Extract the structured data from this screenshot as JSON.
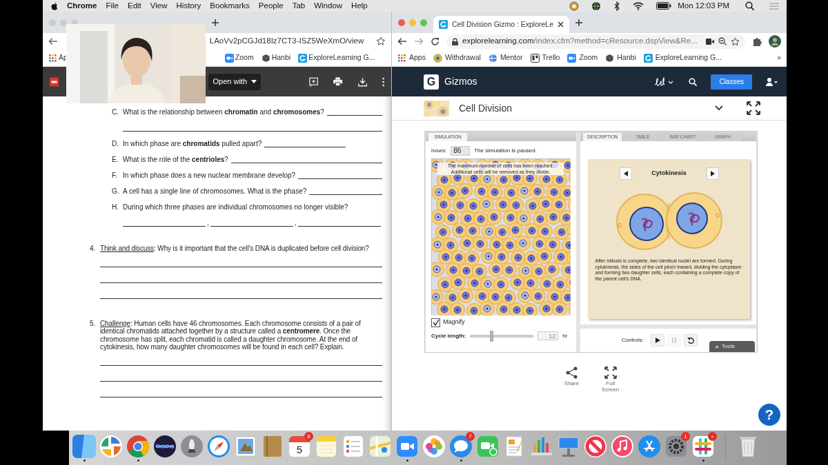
{
  "menu_bar": {
    "app": "Chrome",
    "menus": [
      "File",
      "Edit",
      "View",
      "History",
      "Bookmarks",
      "People",
      "Tab",
      "Window",
      "Help"
    ],
    "clock": "Mon 12:03 PM"
  },
  "left_window": {
    "address": "LAoVv2pCGJd18Iz7CT3-ISZ5WeXmO/view",
    "bookmarks_start": [
      {
        "kind": "grid",
        "label": "Ap"
      }
    ],
    "bookmarks": [
      {
        "kind": "camera",
        "label": "Zoom"
      },
      {
        "kind": "cube",
        "label": "Hanbi"
      },
      {
        "kind": "square-logo",
        "label": "ExploreLearning G..."
      }
    ],
    "open_with": "Open with"
  },
  "pdf": {
    "questions": [
      {
        "letter": "C.",
        "text": "What is the relationship between **chromatin** and **chromosomes**?",
        "kind": "inline-and-line"
      },
      {
        "letter": "D.",
        "text": "In which phase are **chromatids** pulled apart?",
        "kind": "short"
      },
      {
        "letter": "E.",
        "text": "What is the role of the **centrioles**?",
        "kind": "inline"
      },
      {
        "letter": "F.",
        "text": "In which phase does a new nuclear membrane develop?",
        "kind": "inline"
      },
      {
        "letter": "G.",
        "text": "A cell has a single line of chromosomes. What is the phase?",
        "kind": "inline"
      },
      {
        "letter": "H.",
        "text": "During which three phases are individual chromosomes no longer visible?",
        "kind": "three-blanks",
        "separators": [
          ",",
          ","
        ]
      }
    ],
    "numbered": [
      {
        "number": "4.",
        "label": "Think and discuss",
        "text": ": Why is it important that the cell's DNA is duplicated before cell division?",
        "kind": "three-lines"
      },
      {
        "number": "5.",
        "label": "Challenge",
        "text": ": Human cells have 46 chromosomes. Each chromosome consists of a pair of identical chromatids attached together by a structure called a **centromere**. Once the chromosome has split, each chromatid is called a daughter chromosome. At the end of cytokinesis, how many daughter chromosomes will be found in each cell? Explain.",
        "kind": "three-lines"
      }
    ]
  },
  "right_window": {
    "tab_title": "Cell Division Gizmo : ExploreLe",
    "address_host": "explorelearning.com",
    "address_path": "/index.cfm?method=cResource.dspView&Re...",
    "bookmarks": [
      {
        "kind": "grid",
        "label": "Apps"
      },
      {
        "kind": "coin",
        "label": "Withdrawal"
      },
      {
        "kind": "globe",
        "label": "Mentor"
      },
      {
        "kind": "board",
        "label": "Trello"
      },
      {
        "kind": "camera",
        "label": "Zoom"
      },
      {
        "kind": "cube",
        "label": "Hanbi"
      },
      {
        "kind": "square-logo",
        "label": "ExploreLearning G..."
      }
    ],
    "more_bookmarks": "»"
  },
  "gizmos_nav": {
    "letter": "G",
    "brand": "Gizmos",
    "classes": "Classes"
  },
  "gizmo_header": {
    "title": "Cell Division"
  },
  "gizmo": {
    "left_tabs": [
      {
        "label": "SIMULATION",
        "selected": true
      }
    ],
    "right_tabs": [
      {
        "label": "DESCRIPTION",
        "selected": true
      },
      {
        "label": "TABLE",
        "selected": false
      },
      {
        "label": "BAR CHART",
        "selected": false
      },
      {
        "label": "GRAPH",
        "selected": false
      }
    ],
    "hours_label": "hours:",
    "hours": "86",
    "status": "The simulation is paused.",
    "message": [
      "The maximum number of cells has been reached.",
      "Additional cells will be removed as they divide."
    ],
    "magnify": {
      "label": "Magnify",
      "checked": true
    },
    "cycle": {
      "label": "Cycle length:",
      "level": 0.33,
      "value": "12",
      "unit": "hr"
    },
    "phase": "Cytokinesis",
    "description": "After mitosis is complete, two identical nuclei are formed. During cytokinesis, the sides of the cell pinch inward, dividing the cytoplasm and forming two daughter cells, each containing a complete copy of the parent cell's DNA.",
    "controls_label": "Controls:",
    "controls": [
      {
        "kind": "play",
        "disabled": false
      },
      {
        "kind": "pause",
        "disabled": true
      },
      {
        "kind": "reset",
        "disabled": false
      }
    ],
    "tools": "Tools"
  },
  "actions": [
    {
      "kind": "share",
      "label": "Share"
    },
    {
      "kind": "fullscreen",
      "label": "Full Screen"
    }
  ],
  "help": "?",
  "dock": [
    {
      "kind": "split-square",
      "running": true
    },
    {
      "kind": "pinwheel",
      "running": false
    },
    {
      "kind": "browser-circle",
      "running": true
    },
    {
      "kind": "orb",
      "running": false
    },
    {
      "kind": "rocket",
      "running": false
    },
    {
      "kind": "compass",
      "running": false
    },
    {
      "kind": "stamp",
      "running": false
    },
    {
      "kind": "notebook",
      "running": false
    },
    {
      "kind": "calendar",
      "running": false,
      "badge": "8",
      "label": "5"
    },
    {
      "kind": "notepad",
      "running": false
    },
    {
      "kind": "checklist",
      "running": false
    },
    {
      "kind": "map",
      "running": false
    },
    {
      "kind": "video-camera",
      "running": true
    },
    {
      "kind": "flower",
      "running": false
    },
    {
      "kind": "chat-bubble",
      "running": true,
      "badge": "7"
    },
    {
      "kind": "video-call",
      "running": false
    },
    {
      "kind": "document-pen",
      "running": false
    },
    {
      "kind": "bar-chart",
      "running": false
    },
    {
      "kind": "podium",
      "running": false
    },
    {
      "kind": "no-sign",
      "running": false
    },
    {
      "kind": "music-note",
      "running": false
    },
    {
      "kind": "app-store",
      "running": false
    },
    {
      "kind": "gear",
      "running": false,
      "badge": "1"
    },
    {
      "kind": "hash",
      "running": true,
      "badge": "•"
    },
    {
      "kind": "trash",
      "running": false
    }
  ]
}
